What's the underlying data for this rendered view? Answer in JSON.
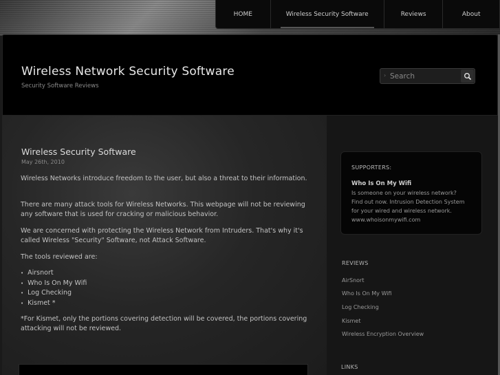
{
  "nav": {
    "items": [
      "HOME",
      "Wireless Security Software",
      "Reviews",
      "About"
    ]
  },
  "header": {
    "title": "Wireless Network Security Software",
    "tagline": "Security Software Reviews"
  },
  "search": {
    "placeholder": "Search"
  },
  "post": {
    "title": "Wireless Security Software",
    "date": "May 26th, 2010",
    "paragraphs": [
      "Wireless Networks introduce freedom to the user, but also a threat to their information.",
      "There are many attack tools for Wireless Networks.  This webpage will not be reviewing any software that is used for cracking  or malicious behavior.",
      "We are concerned with protecting the Wireless Network from Intruders.  That's why it's called Wireless \"Security\" Software, not Attack Software.",
      "The tools reviewed are:"
    ],
    "tools": [
      "Airsnort",
      "Who Is On My Wifi",
      "Log Checking",
      "Kismet *"
    ],
    "footnote": "*For Kismet, only the portions covering detection will be covered, the portions covering attacking will not be reviewed."
  },
  "sidebar": {
    "supporters": {
      "heading": "SUPPORTERS:",
      "title": "Who Is On My Wifi",
      "lines": [
        "Is someone on your wireless network?",
        "Find out now. Intrusion Detection System",
        "for your wired and wireless network.",
        "www.whoisonmywifi.com"
      ]
    },
    "reviews_heading": "REVIEWS",
    "reviews": [
      "AirSnort",
      "Who Is On My Wifi",
      "Log Checking",
      "Kismet",
      "Wireless Encryption Overview"
    ],
    "links_heading": "LINKS"
  }
}
